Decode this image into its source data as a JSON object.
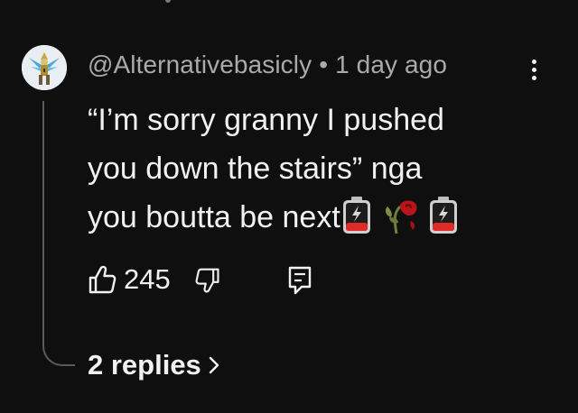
{
  "comment": {
    "author": "@Alternativebasicly",
    "separator": "•",
    "timestamp": "1 day ago",
    "text_lines": [
      "“I’m sorry granny I pushed",
      "you down the stairs” nga",
      "you boutta be next"
    ],
    "emoji_icons": [
      "low-battery-icon",
      "wilted-rose-icon",
      "low-battery-icon"
    ],
    "like_count": "245",
    "replies_label": "2 replies"
  },
  "colors": {
    "background": "#0f0f0f",
    "text": "#f1f1f1",
    "meta_text": "#aaaaaa",
    "thread_line": "#5a5a5a"
  }
}
